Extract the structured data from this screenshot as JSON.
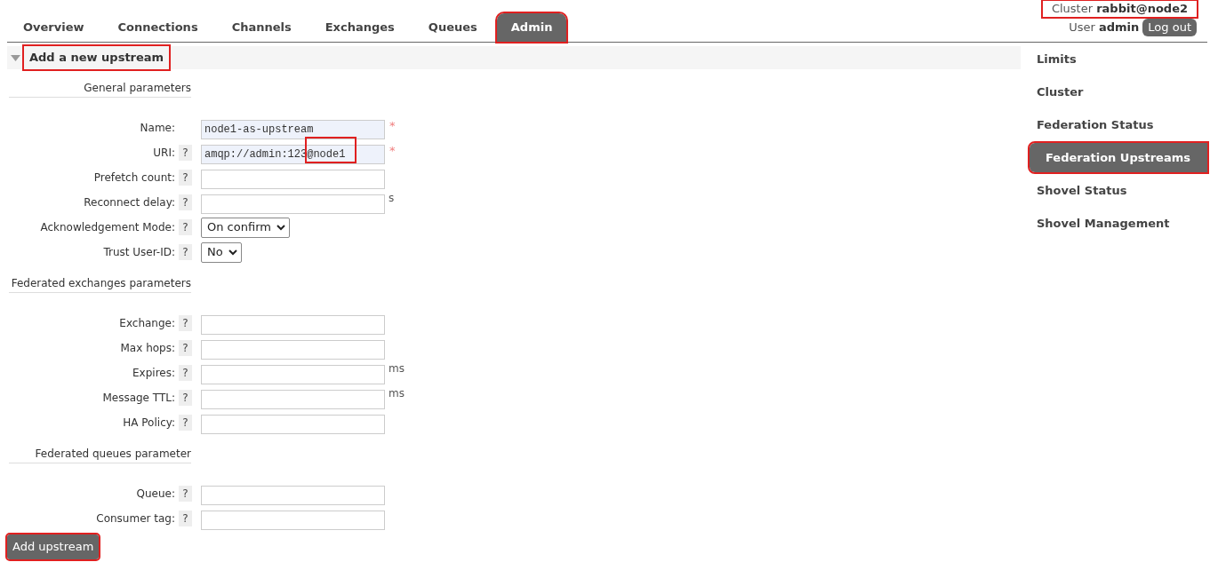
{
  "tabs": [
    {
      "label": "Overview",
      "selected": false
    },
    {
      "label": "Connections",
      "selected": false
    },
    {
      "label": "Channels",
      "selected": false
    },
    {
      "label": "Exchanges",
      "selected": false
    },
    {
      "label": "Queues",
      "selected": false
    },
    {
      "label": "Admin",
      "selected": true,
      "highlighted": true
    }
  ],
  "header": {
    "cluster_label": "Cluster",
    "cluster": "rabbit@node2",
    "cluster_highlighted": true,
    "user_label": "User",
    "user": "admin",
    "logout": "Log out"
  },
  "section": {
    "title": "Add a new upstream",
    "expanded": true,
    "highlighted": true
  },
  "groups": [
    {
      "title": "General parameters",
      "fields": [
        {
          "label": "Name:",
          "kind": "text",
          "value": "node1-as-upstream",
          "required": "*",
          "filled": true
        },
        {
          "label": "URI:",
          "kind": "text",
          "help": "?",
          "value": "amqp://admin:123@node1",
          "required": "*",
          "filled": true,
          "annotated": true
        },
        {
          "label": "Prefetch count:",
          "kind": "text",
          "help": "?",
          "filled": false
        },
        {
          "label": "Reconnect delay:",
          "kind": "text",
          "help": "?",
          "filled": false,
          "unit": "s"
        },
        {
          "label": "Acknowledgement Mode:",
          "kind": "select",
          "help": "?",
          "value": "On confirm"
        },
        {
          "label": "Trust User-ID:",
          "kind": "select",
          "help": "?",
          "value": "No"
        }
      ]
    },
    {
      "title": "Federated exchanges parameters",
      "fields": [
        {
          "label": "Exchange:",
          "kind": "text",
          "help": "?",
          "filled": false
        },
        {
          "label": "Max hops:",
          "kind": "text",
          "help": "?",
          "filled": false
        },
        {
          "label": "Expires:",
          "kind": "text",
          "help": "?",
          "filled": false,
          "unit": "ms"
        },
        {
          "label": "Message TTL:",
          "kind": "text",
          "help": "?",
          "filled": false,
          "unit": "ms"
        },
        {
          "label": "HA Policy:",
          "kind": "text",
          "help": "?",
          "filled": false
        }
      ]
    },
    {
      "title": "Federated queues parameter",
      "fields": [
        {
          "label": "Queue:",
          "kind": "text",
          "help": "?",
          "filled": false
        },
        {
          "label": "Consumer tag:",
          "kind": "text",
          "help": "?",
          "filled": false
        }
      ]
    }
  ],
  "submit": {
    "label": "Add upstream",
    "highlighted": true
  },
  "sidebar": {
    "items": [
      {
        "label": "Limits",
        "selected": false
      },
      {
        "label": "Cluster",
        "selected": false
      },
      {
        "label": "Federation Status",
        "selected": false
      },
      {
        "label": "Federation Upstreams",
        "selected": true,
        "highlighted": true
      },
      {
        "label": "Shovel Status",
        "selected": false
      },
      {
        "label": "Shovel Management",
        "selected": false
      }
    ]
  }
}
